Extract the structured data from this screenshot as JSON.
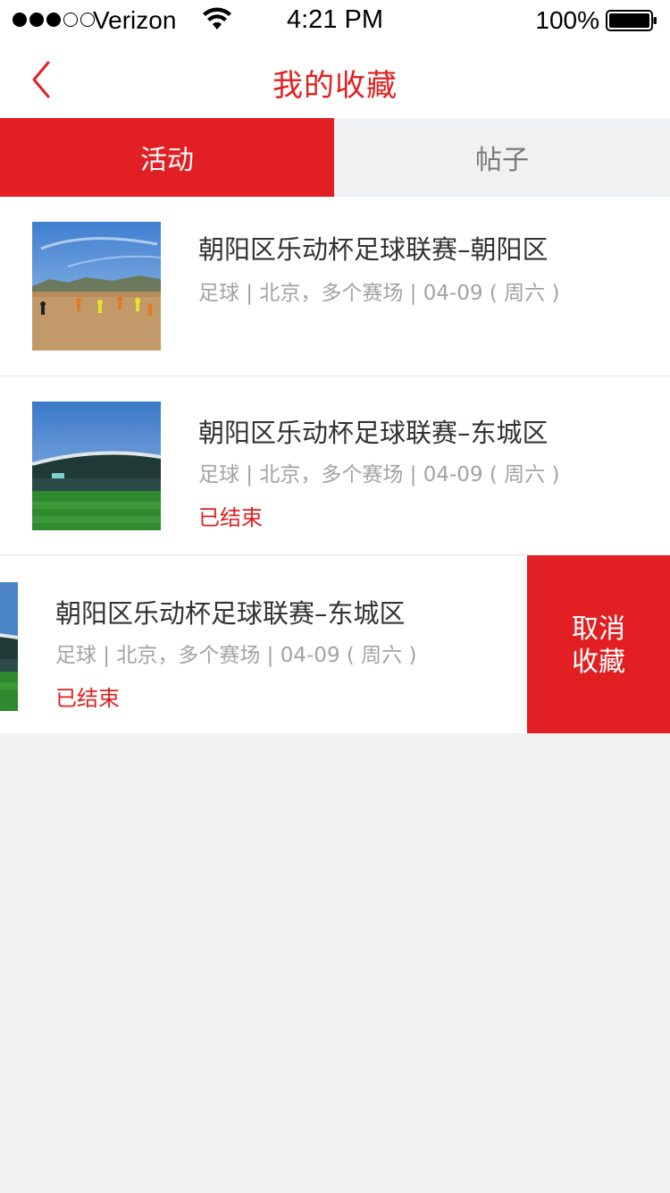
{
  "status_bar": {
    "carrier": "Verizon",
    "time": "4:21 PM",
    "battery": "100%",
    "signal_icon": "signal-dots-icon",
    "wifi_icon": "wifi-icon",
    "battery_icon": "battery-icon"
  },
  "nav": {
    "title": "我的收藏",
    "back_icon": "chevron-left-icon"
  },
  "tabs": [
    {
      "label": "活动",
      "active": true
    },
    {
      "label": "帖子",
      "active": false
    }
  ],
  "items": [
    {
      "title": "朝阳区乐动杯足球联赛–朝阳区",
      "meta": "足球 | 北京，多个赛场 | 04-09 ( 周六 )",
      "status": ""
    },
    {
      "title": "朝阳区乐动杯足球联赛–东城区",
      "meta": "足球 | 北京，多个赛场 | 04-09 ( 周六 )",
      "status": "已结束"
    },
    {
      "title": "朝阳区乐动杯足球联赛–东城区",
      "meta": "足球 | 北京，多个赛场 | 04-09 ( 周六 )",
      "status": "已结束"
    }
  ],
  "swipe_action": {
    "line1": "取消",
    "line2": "收藏"
  },
  "colors": {
    "accent": "#e21f22",
    "background": "#f0f1f3"
  }
}
